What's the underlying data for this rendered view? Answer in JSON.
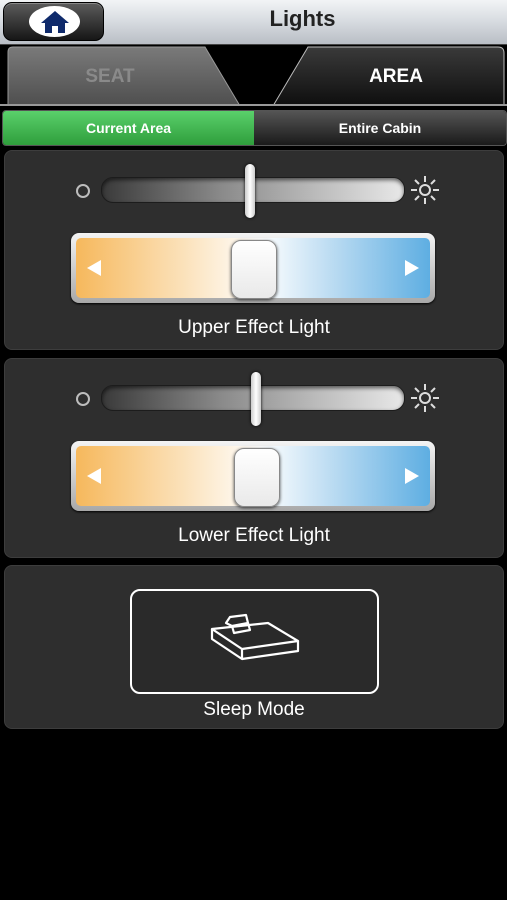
{
  "header": {
    "title": "Lights",
    "home_icon": "home-icon"
  },
  "tabs": [
    {
      "label": "SEAT",
      "active": false
    },
    {
      "label": "AREA",
      "active": true
    }
  ],
  "segmented": [
    {
      "label": "Current Area",
      "selected": true
    },
    {
      "label": "Entire Cabin",
      "selected": false
    }
  ],
  "panels": [
    {
      "label": "Upper Effect Light",
      "brightness": 0.49,
      "color_temperature": 0.5
    },
    {
      "label": "Lower Effect Light",
      "brightness": 0.51,
      "color_temperature": 0.51
    }
  ],
  "sleep": {
    "label": "Sleep Mode",
    "icon": "bed-icon"
  },
  "colors": {
    "accent_green": "#3cb04a",
    "warm": "#f6b85c",
    "cool": "#5eaee2"
  }
}
